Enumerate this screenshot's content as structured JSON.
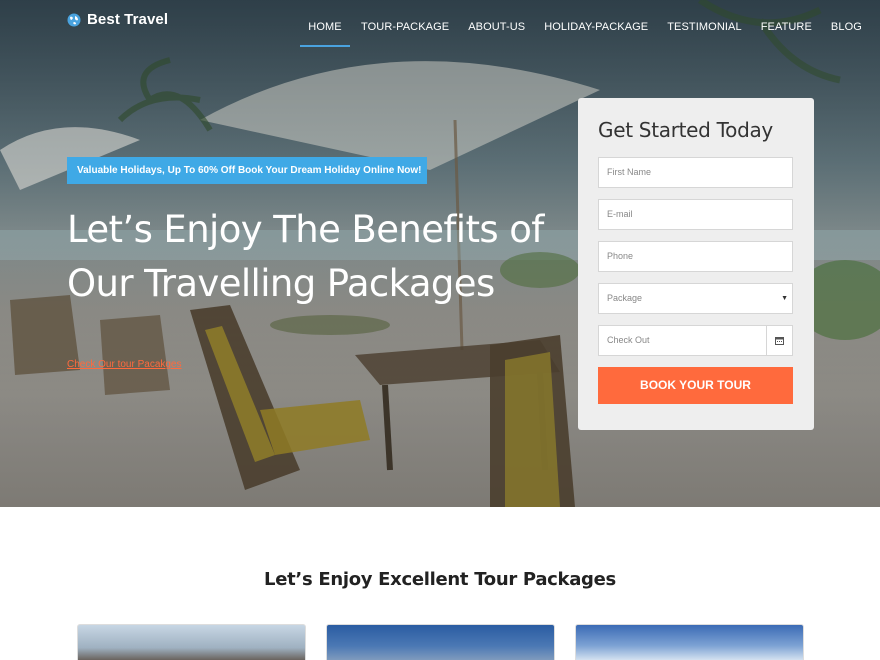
{
  "brand": {
    "name": "Best Travel",
    "icon": "globe-icon"
  },
  "nav": {
    "items": [
      {
        "label": "HOME",
        "active": true
      },
      {
        "label": "TOUR-PACKAGE"
      },
      {
        "label": "ABOUT-US"
      },
      {
        "label": "HOLIDAY-PACKAGE"
      },
      {
        "label": "TESTIMONIAL"
      },
      {
        "label": "FEATURE"
      },
      {
        "label": "BLOG"
      }
    ]
  },
  "hero": {
    "promo": "Valuable Holidays, Up To 60% Off Book Your Dream Holiday Online Now!",
    "headline_line1": "Let’s Enjoy The Benefits of",
    "headline_line2": "Our Travelling Packages",
    "link": "Check Our tour Pacakges"
  },
  "form": {
    "title": "Get Started Today",
    "first_name_placeholder": "First Name",
    "email_placeholder": "E-mail",
    "phone_placeholder": "Phone",
    "package_selected": "Package",
    "checkout_placeholder": "Check Out",
    "submit_label": "BOOK YOUR TOUR"
  },
  "section": {
    "title": "Let’s Enjoy Excellent Tour Packages"
  },
  "colors": {
    "accent": "#3fa9e6",
    "cta": "#ff6a3d",
    "nav_underline": "#4aa3df"
  }
}
